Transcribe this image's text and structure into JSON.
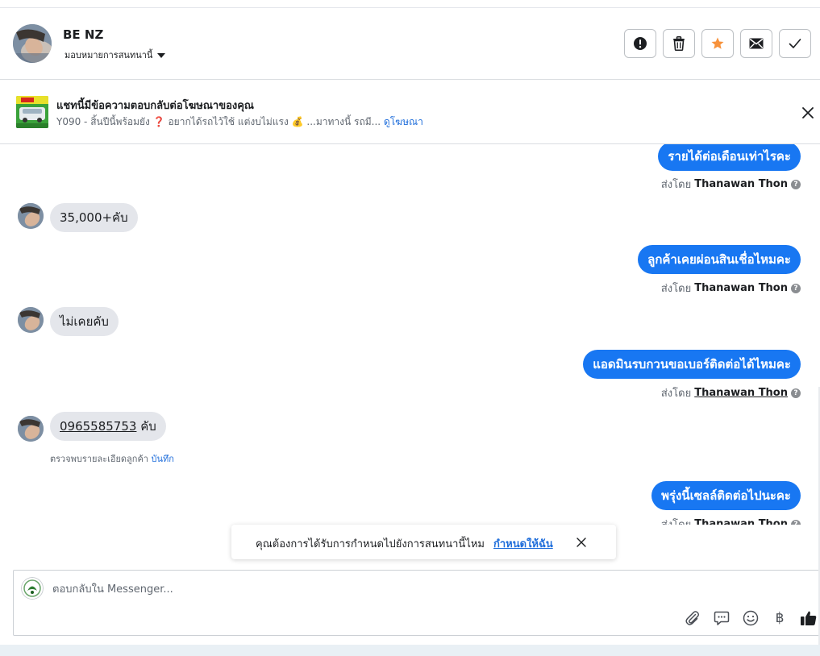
{
  "header": {
    "contact_name": "BE NZ",
    "assign_label": "มอบหมายการสนทนานี้",
    "actions": [
      "spam-icon",
      "delete-icon",
      "star-icon",
      "mail-icon",
      "done-icon"
    ],
    "star_color": "#f7923b"
  },
  "ad_banner": {
    "title": "แชทนี้มีข้อความตอบกลับต่อโฆษณาของคุณ",
    "desc_prefix": "Y090 - สิ้นปีนี้พร้อมยัง ❓ อยากได้รถไว้ใช้ แต่งบไม่แรง 💰 ...มาทางนี้ รถมี...",
    "link": "ดูโฆษณา"
  },
  "messages": [
    {
      "dir": "out",
      "text": "รายได้ต่อเดือนเท่าไรคะ",
      "sent_prefix": "ส่งโดย",
      "sender": "Thanawan Thon"
    },
    {
      "dir": "in",
      "text": "35,000+คับ"
    },
    {
      "dir": "out",
      "text": "ลูกค้าเคยผ่อนสินเชื่อไหมคะ",
      "sent_prefix": "ส่งโดย",
      "sender": "Thanawan Thon"
    },
    {
      "dir": "in",
      "text": "ไม่เคยคับ"
    },
    {
      "dir": "out",
      "text": "แอดมินรบกวนขอเบอร์ติดต่อได้ไหมคะ",
      "sent_prefix": "ส่งโดย",
      "sender": "Thanawan Thon"
    },
    {
      "dir": "in",
      "phone": "0965585753",
      "suffix": " คับ",
      "note": "ตรวจพบรายละเอียดลูกค้า",
      "note_link": "บันทึก"
    },
    {
      "dir": "out",
      "text": "พรุ่งนี้เซลล์ติดต่อไปนะคะ",
      "sent_prefix": "ส่งโดย",
      "sender": "Thanawan Thon"
    }
  ],
  "toast": {
    "text": "คุณต้องการได้รับการกำหนดไปยังการสนทนานี้ไหม",
    "link": "กำหนดให้ฉัน"
  },
  "composer": {
    "placeholder": "ตอบกลับใน Messenger...",
    "tools": [
      "attachment-icon",
      "saved-reply-icon",
      "emoji-icon",
      "baht-icon",
      "like-icon"
    ],
    "baht_glyph": "฿"
  },
  "colors": {
    "accent": "#1877f2",
    "link": "#216fdb",
    "incoming_bubble": "#e4e6eb"
  }
}
